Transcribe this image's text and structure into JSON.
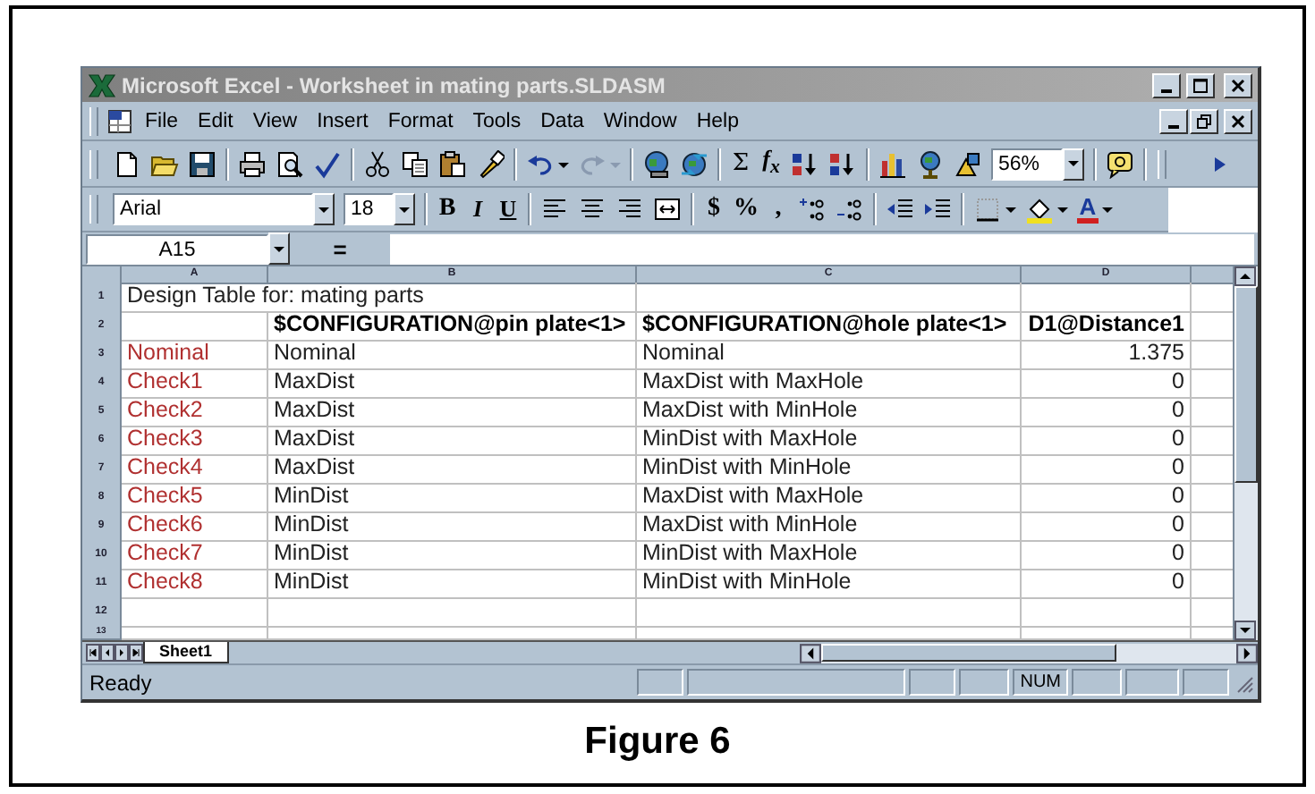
{
  "window": {
    "title": "Microsoft Excel - Worksheet in mating parts.SLDASM"
  },
  "menu": [
    "File",
    "Edit",
    "View",
    "Insert",
    "Format",
    "Tools",
    "Data",
    "Window",
    "Help"
  ],
  "standard_toolbar": {
    "autosum": "Σ",
    "function": "f$_{x}$",
    "zoom": "56%"
  },
  "formatting_toolbar": {
    "font": "Arial",
    "size": "18",
    "bold": "B",
    "italic": "I",
    "underline": "U",
    "currency": "$",
    "percent": "%",
    "comma": ",",
    "font_color": "A"
  },
  "formula_bar": {
    "name_box": "A15",
    "equals": "="
  },
  "columns": [
    "A",
    "B",
    "C",
    "D"
  ],
  "rows": [
    {
      "number": "1",
      "kind": "title",
      "a": "Design Table for: mating parts"
    },
    {
      "number": "2",
      "kind": "header",
      "b": "$CONFIGURATION@pin plate<1>",
      "c": "$CONFIGURATION@hole plate<1>",
      "d": "D1@Distance1"
    },
    {
      "number": "3",
      "kind": "data",
      "a": "Nominal",
      "b": "Nominal",
      "c": "Nominal",
      "d": "1.375"
    },
    {
      "number": "4",
      "kind": "data",
      "a": "Check1",
      "b": "MaxDist",
      "c": "MaxDist with MaxHole",
      "d": "0"
    },
    {
      "number": "5",
      "kind": "data",
      "a": "Check2",
      "b": "MaxDist",
      "c": "MaxDist with MinHole",
      "d": "0"
    },
    {
      "number": "6",
      "kind": "data",
      "a": "Check3",
      "b": "MaxDist",
      "c": "MinDist with MaxHole",
      "d": "0"
    },
    {
      "number": "7",
      "kind": "data",
      "a": "Check4",
      "b": "MaxDist",
      "c": "MinDist with MinHole",
      "d": "0"
    },
    {
      "number": "8",
      "kind": "data",
      "a": "Check5",
      "b": "MinDist",
      "c": "MaxDist with MaxHole",
      "d": "0"
    },
    {
      "number": "9",
      "kind": "data",
      "a": "Check6",
      "b": "MinDist",
      "c": "MaxDist with MinHole",
      "d": "0"
    },
    {
      "number": "10",
      "kind": "data",
      "a": "Check7",
      "b": "MinDist",
      "c": "MinDist with MaxHole",
      "d": "0"
    },
    {
      "number": "11",
      "kind": "data",
      "a": "Check8",
      "b": "MinDist",
      "c": "MinDist with MinHole",
      "d": "0"
    },
    {
      "number": "12",
      "kind": "empty"
    },
    {
      "number": "13",
      "kind": "empty"
    }
  ],
  "sheet_tabs": [
    {
      "label": "Sheet1",
      "selected": true
    }
  ],
  "status_bar": {
    "text": "Ready",
    "num": "NUM"
  },
  "caption": "Figure 6"
}
